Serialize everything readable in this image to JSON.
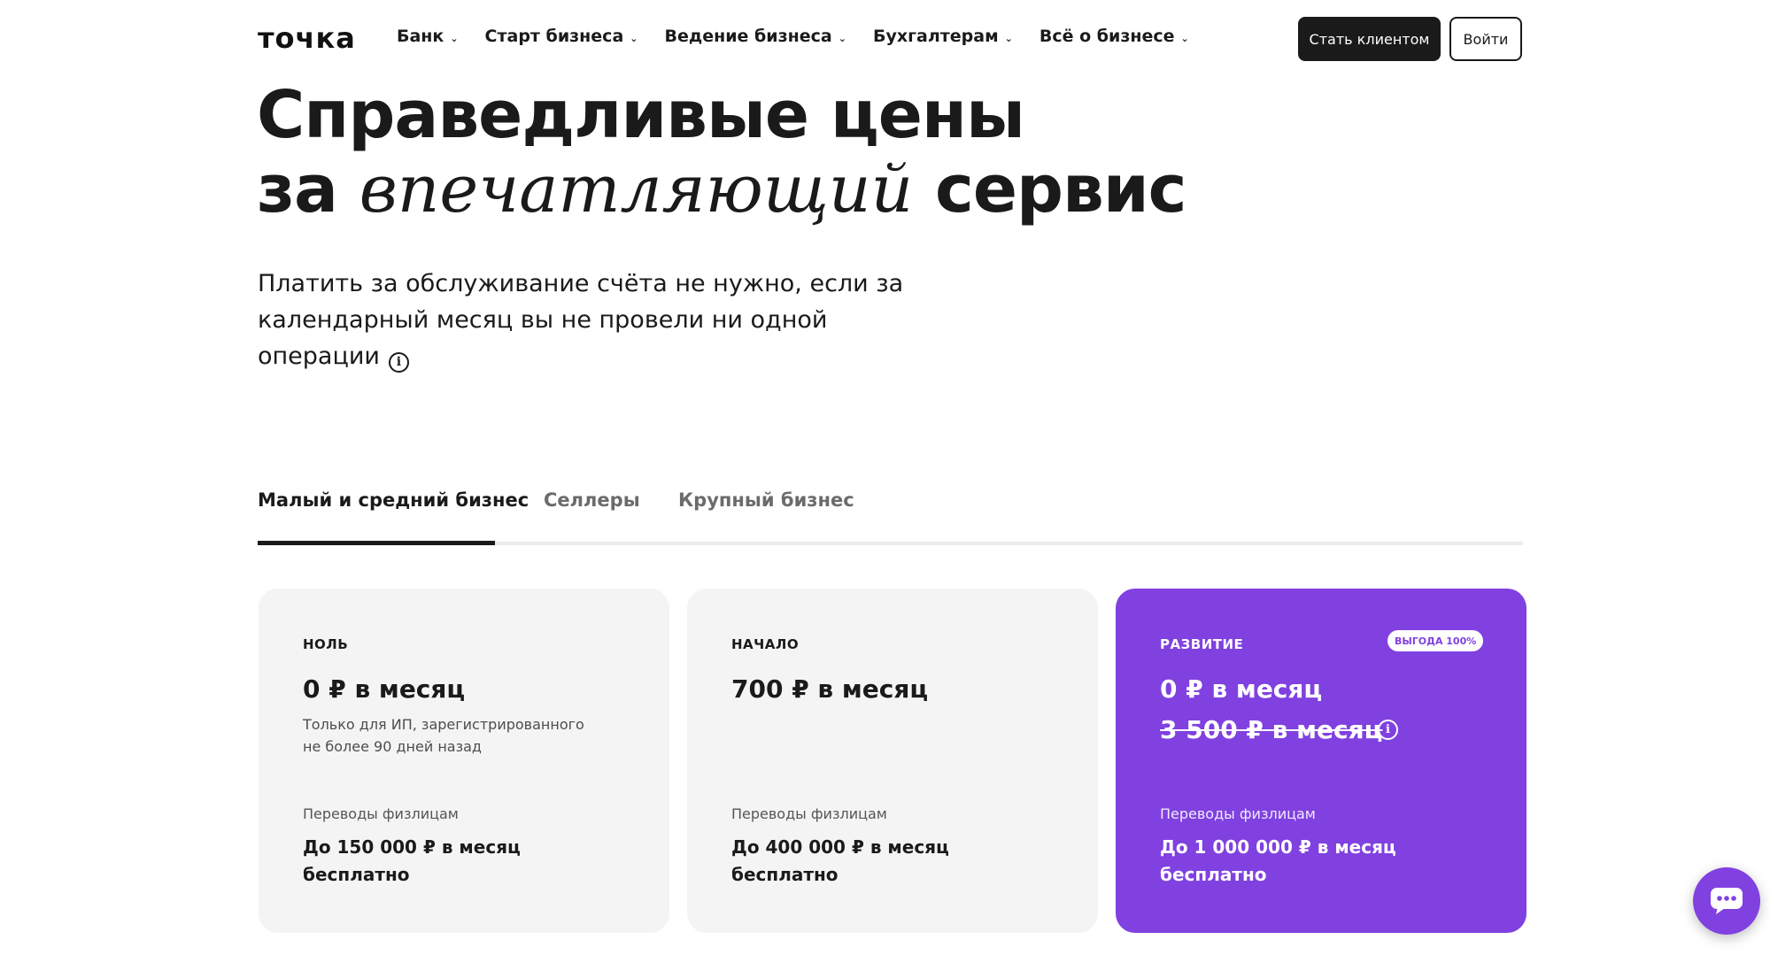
{
  "header": {
    "logo": "точка",
    "nav": [
      {
        "label": "Банк"
      },
      {
        "label": "Старт бизнеса"
      },
      {
        "label": "Ведение бизнеса"
      },
      {
        "label": "Бухгалтерам"
      },
      {
        "label": "Всё о бизнесе"
      }
    ],
    "become_client_label": "Стать клиентом",
    "login_label": "Войти"
  },
  "hero": {
    "title_line1": "Справедливые цены",
    "title_line2_prefix": "за",
    "title_line2_script": "впечатляющий",
    "title_line2_suffix": "сервис",
    "subtitle": "Платить за обслуживание счёта не нужно, если за календарный месяц вы не провели ни одной операции"
  },
  "tabs": [
    {
      "label": "Малый и средний бизнес",
      "active": true
    },
    {
      "label": "Селлеры",
      "active": false
    },
    {
      "label": "Крупный бизнес",
      "active": false
    }
  ],
  "plans": [
    {
      "name": "НОЛЬ",
      "price": "0 ₽ в месяц",
      "note": "Только для ИП, зарегистрированного не более 90 дней назад",
      "transfer_label": "Переводы физлицам",
      "transfer_value": "До 150 000 ₽ в месяц бесплатно"
    },
    {
      "name": "НАЧАЛО",
      "price": "700 ₽ в месяц",
      "transfer_label": "Переводы физлицам",
      "transfer_value": "До 400 000 ₽ в месяц бесплатно"
    },
    {
      "name": "РАЗВИТИЕ",
      "badge": "ВЫГОДА 100%",
      "price": "0 ₽ в месяц",
      "old_price": "3 500 ₽ в месяц",
      "transfer_label": "Переводы физлицам",
      "transfer_value": "До 1 000 000 ₽ в месяц бесплатно"
    }
  ],
  "colors": {
    "accent": "#8041e0",
    "dark": "#1a1a1a",
    "card_bg": "#f4f4f4"
  },
  "icons": {
    "nav_chevron": "chevron-down-icon",
    "info": "info-icon",
    "chat": "chat-icon"
  }
}
